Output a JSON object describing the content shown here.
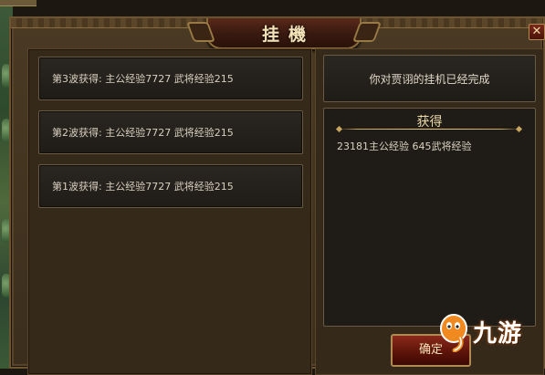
{
  "window": {
    "title": "挂機",
    "close_symbol": "✕"
  },
  "waves": [
    {
      "label": "第3波获得: 主公经验7727  武将经验215"
    },
    {
      "label": "第2波获得: 主公经验7727  武将经验215"
    },
    {
      "label": "第1波获得: 主公经验7727  武将经验215"
    }
  ],
  "message": "你对贾诩的挂机已经完成",
  "reward": {
    "title": "获得",
    "summary": "23181主公经验  645武将经验"
  },
  "confirm_button": {
    "label": "确定"
  },
  "watermark": {
    "text": "九游",
    "logo_icon": "jiuyou-logo"
  },
  "colors": {
    "accent_gold": "#c8a860",
    "button_red": "#8a2a1a",
    "watermark_orange": "#e86a10"
  }
}
